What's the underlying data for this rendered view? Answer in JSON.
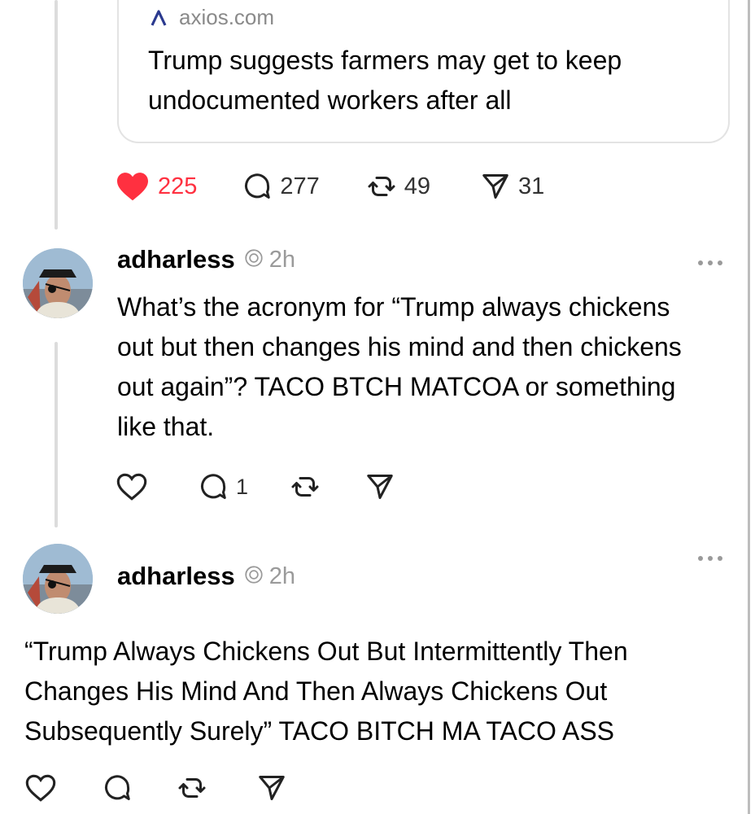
{
  "quoted_post": {
    "domain": "axios.com",
    "domain_icon": "axios-logo-icon",
    "title": "Trump suggests farmers may get to keep undocumented workers after all",
    "likes": "225",
    "replies": "277",
    "reposts": "49",
    "shares": "31",
    "liked": true,
    "like_color": "#ff3040"
  },
  "reply_1": {
    "username": "adharless",
    "timestamp": "2h",
    "text": "What’s the acronym for “Trump always chickens out but then changes his mind and then chickens out again”? TACO BTCH MATCOA or something like that.",
    "replies": "1"
  },
  "reply_2": {
    "username": "adharless",
    "timestamp": "2h",
    "text": "“Trump Always Chickens Out But Intermittently Then Changes His Mind And Then Always Chickens Out Subsequently Surely” TACO BITCH MA TACO ASS"
  }
}
